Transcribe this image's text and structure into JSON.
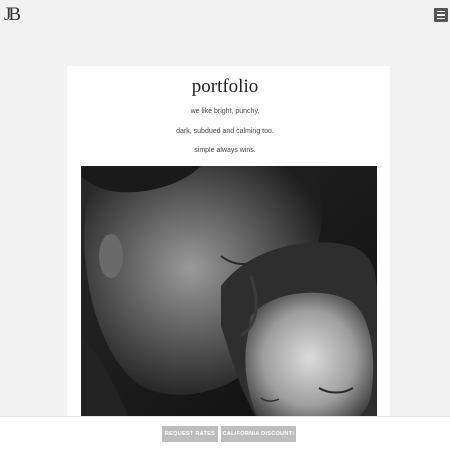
{
  "header": {
    "logo_text": "JB",
    "menu_icon": "hamburger-icon"
  },
  "main": {
    "title": "portfolio",
    "taglines": [
      "we like bright, punchy,",
      "dark, subdued and calming too.",
      "simple always wins."
    ],
    "photo": {
      "description_icon": "photo-couple-bw"
    }
  },
  "footer": {
    "request_rates_label": "REQUEST RATES",
    "california_discount_label": "CALIFORNIA DISCOUNT!"
  },
  "colors": {
    "background": "#f2f2f2",
    "card": "#ffffff",
    "button": "#bdbdbd",
    "menu_button": "#555555"
  }
}
